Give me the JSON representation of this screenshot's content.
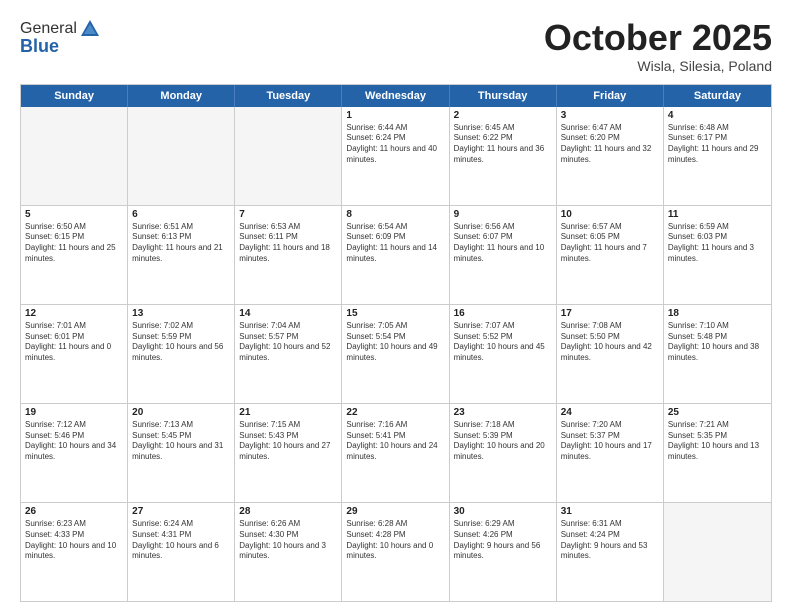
{
  "logo": {
    "general": "General",
    "blue": "Blue"
  },
  "title": "October 2025",
  "location": "Wisla, Silesia, Poland",
  "days_of_week": [
    "Sunday",
    "Monday",
    "Tuesday",
    "Wednesday",
    "Thursday",
    "Friday",
    "Saturday"
  ],
  "weeks": [
    [
      {
        "day": "",
        "empty": true
      },
      {
        "day": "",
        "empty": true
      },
      {
        "day": "",
        "empty": true
      },
      {
        "day": "1",
        "sunrise": "6:44 AM",
        "sunset": "6:24 PM",
        "daylight": "11 hours and 40 minutes."
      },
      {
        "day": "2",
        "sunrise": "6:45 AM",
        "sunset": "6:22 PM",
        "daylight": "11 hours and 36 minutes."
      },
      {
        "day": "3",
        "sunrise": "6:47 AM",
        "sunset": "6:20 PM",
        "daylight": "11 hours and 32 minutes."
      },
      {
        "day": "4",
        "sunrise": "6:48 AM",
        "sunset": "6:17 PM",
        "daylight": "11 hours and 29 minutes."
      }
    ],
    [
      {
        "day": "5",
        "sunrise": "6:50 AM",
        "sunset": "6:15 PM",
        "daylight": "11 hours and 25 minutes."
      },
      {
        "day": "6",
        "sunrise": "6:51 AM",
        "sunset": "6:13 PM",
        "daylight": "11 hours and 21 minutes."
      },
      {
        "day": "7",
        "sunrise": "6:53 AM",
        "sunset": "6:11 PM",
        "daylight": "11 hours and 18 minutes."
      },
      {
        "day": "8",
        "sunrise": "6:54 AM",
        "sunset": "6:09 PM",
        "daylight": "11 hours and 14 minutes."
      },
      {
        "day": "9",
        "sunrise": "6:56 AM",
        "sunset": "6:07 PM",
        "daylight": "11 hours and 10 minutes."
      },
      {
        "day": "10",
        "sunrise": "6:57 AM",
        "sunset": "6:05 PM",
        "daylight": "11 hours and 7 minutes."
      },
      {
        "day": "11",
        "sunrise": "6:59 AM",
        "sunset": "6:03 PM",
        "daylight": "11 hours and 3 minutes."
      }
    ],
    [
      {
        "day": "12",
        "sunrise": "7:01 AM",
        "sunset": "6:01 PM",
        "daylight": "11 hours and 0 minutes."
      },
      {
        "day": "13",
        "sunrise": "7:02 AM",
        "sunset": "5:59 PM",
        "daylight": "10 hours and 56 minutes."
      },
      {
        "day": "14",
        "sunrise": "7:04 AM",
        "sunset": "5:57 PM",
        "daylight": "10 hours and 52 minutes."
      },
      {
        "day": "15",
        "sunrise": "7:05 AM",
        "sunset": "5:54 PM",
        "daylight": "10 hours and 49 minutes."
      },
      {
        "day": "16",
        "sunrise": "7:07 AM",
        "sunset": "5:52 PM",
        "daylight": "10 hours and 45 minutes."
      },
      {
        "day": "17",
        "sunrise": "7:08 AM",
        "sunset": "5:50 PM",
        "daylight": "10 hours and 42 minutes."
      },
      {
        "day": "18",
        "sunrise": "7:10 AM",
        "sunset": "5:48 PM",
        "daylight": "10 hours and 38 minutes."
      }
    ],
    [
      {
        "day": "19",
        "sunrise": "7:12 AM",
        "sunset": "5:46 PM",
        "daylight": "10 hours and 34 minutes."
      },
      {
        "day": "20",
        "sunrise": "7:13 AM",
        "sunset": "5:45 PM",
        "daylight": "10 hours and 31 minutes."
      },
      {
        "day": "21",
        "sunrise": "7:15 AM",
        "sunset": "5:43 PM",
        "daylight": "10 hours and 27 minutes."
      },
      {
        "day": "22",
        "sunrise": "7:16 AM",
        "sunset": "5:41 PM",
        "daylight": "10 hours and 24 minutes."
      },
      {
        "day": "23",
        "sunrise": "7:18 AM",
        "sunset": "5:39 PM",
        "daylight": "10 hours and 20 minutes."
      },
      {
        "day": "24",
        "sunrise": "7:20 AM",
        "sunset": "5:37 PM",
        "daylight": "10 hours and 17 minutes."
      },
      {
        "day": "25",
        "sunrise": "7:21 AM",
        "sunset": "5:35 PM",
        "daylight": "10 hours and 13 minutes."
      }
    ],
    [
      {
        "day": "26",
        "sunrise": "6:23 AM",
        "sunset": "4:33 PM",
        "daylight": "10 hours and 10 minutes."
      },
      {
        "day": "27",
        "sunrise": "6:24 AM",
        "sunset": "4:31 PM",
        "daylight": "10 hours and 6 minutes."
      },
      {
        "day": "28",
        "sunrise": "6:26 AM",
        "sunset": "4:30 PM",
        "daylight": "10 hours and 3 minutes."
      },
      {
        "day": "29",
        "sunrise": "6:28 AM",
        "sunset": "4:28 PM",
        "daylight": "10 hours and 0 minutes."
      },
      {
        "day": "30",
        "sunrise": "6:29 AM",
        "sunset": "4:26 PM",
        "daylight": "9 hours and 56 minutes."
      },
      {
        "day": "31",
        "sunrise": "6:31 AM",
        "sunset": "4:24 PM",
        "daylight": "9 hours and 53 minutes."
      },
      {
        "day": "",
        "empty": true
      }
    ]
  ]
}
